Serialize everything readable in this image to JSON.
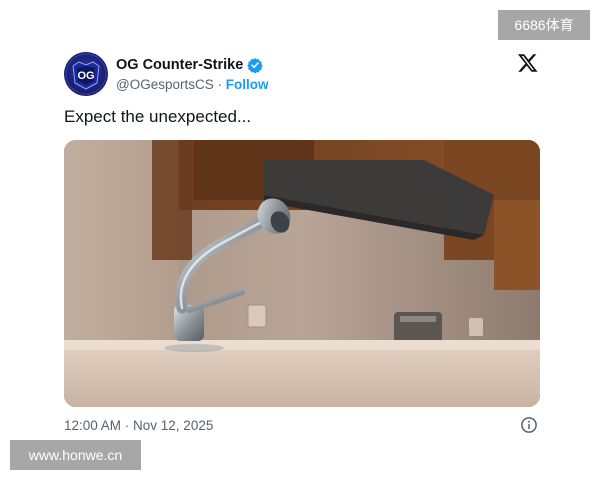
{
  "watermarks": {
    "top_right": "6686体育",
    "bottom_left": "www.honwe.cn"
  },
  "tweet": {
    "author": {
      "display_name": "OG Counter-Strike",
      "handle": "@OGesportsCS",
      "separator": "·",
      "follow_label": "Follow",
      "verified": true,
      "avatar_logo_text": "OG"
    },
    "platform_icon": "x-logo-icon",
    "text": "Expect the unexpected...",
    "media": {
      "kind": "photo",
      "subject": "kitchen-faucet"
    },
    "timestamp": "12:00 AM · Nov 12, 2025",
    "info_icon": "info-icon"
  },
  "colors": {
    "link_blue": "#1d9bf0",
    "secondary_text": "#536471",
    "primary_text": "#0f1419",
    "verified_badge": "#1d9bf0",
    "watermark_bg": "#a7a7a7"
  }
}
